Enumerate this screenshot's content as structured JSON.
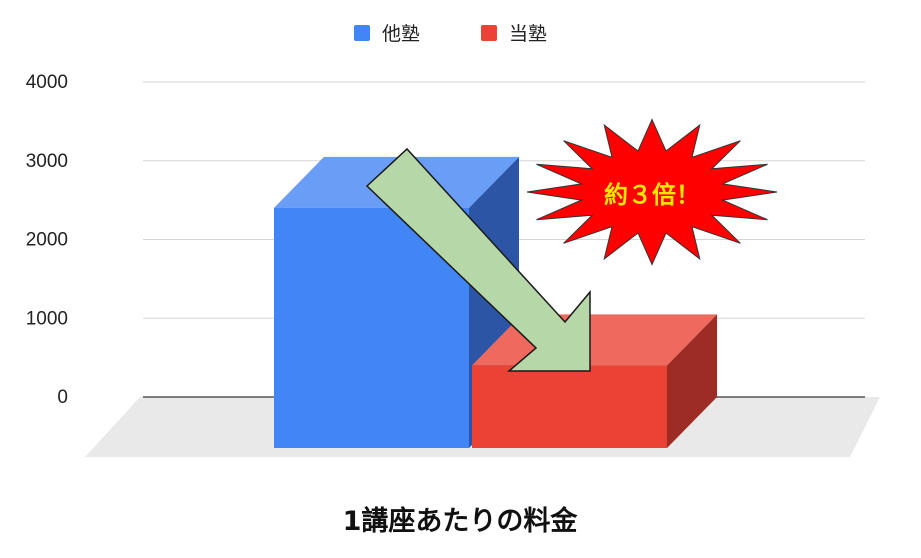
{
  "chart_data": {
    "type": "bar",
    "style": "3d",
    "title": "1講座あたりの料金",
    "xlabel": "",
    "ylabel": "",
    "categories": [
      ""
    ],
    "series": [
      {
        "name": "他塾",
        "values": [
          3050
        ],
        "color": "#4285f4",
        "side_color": "#2c56a5",
        "top_color": "#6a9df5"
      },
      {
        "name": "当塾",
        "values": [
          1050
        ],
        "color": "#ea4335",
        "side_color": "#9c2c24",
        "top_color": "#ee6a5e"
      }
    ],
    "ylim": [
      0,
      4000
    ],
    "yticks": [
      0,
      1000,
      2000,
      3000,
      4000
    ],
    "grid": true,
    "legend_position": "top-center",
    "annotation": {
      "text": "約３倍！",
      "fill_color": "#ff0000",
      "text_color": "#ffe600",
      "arrow_color": "#b6d7a8"
    }
  }
}
